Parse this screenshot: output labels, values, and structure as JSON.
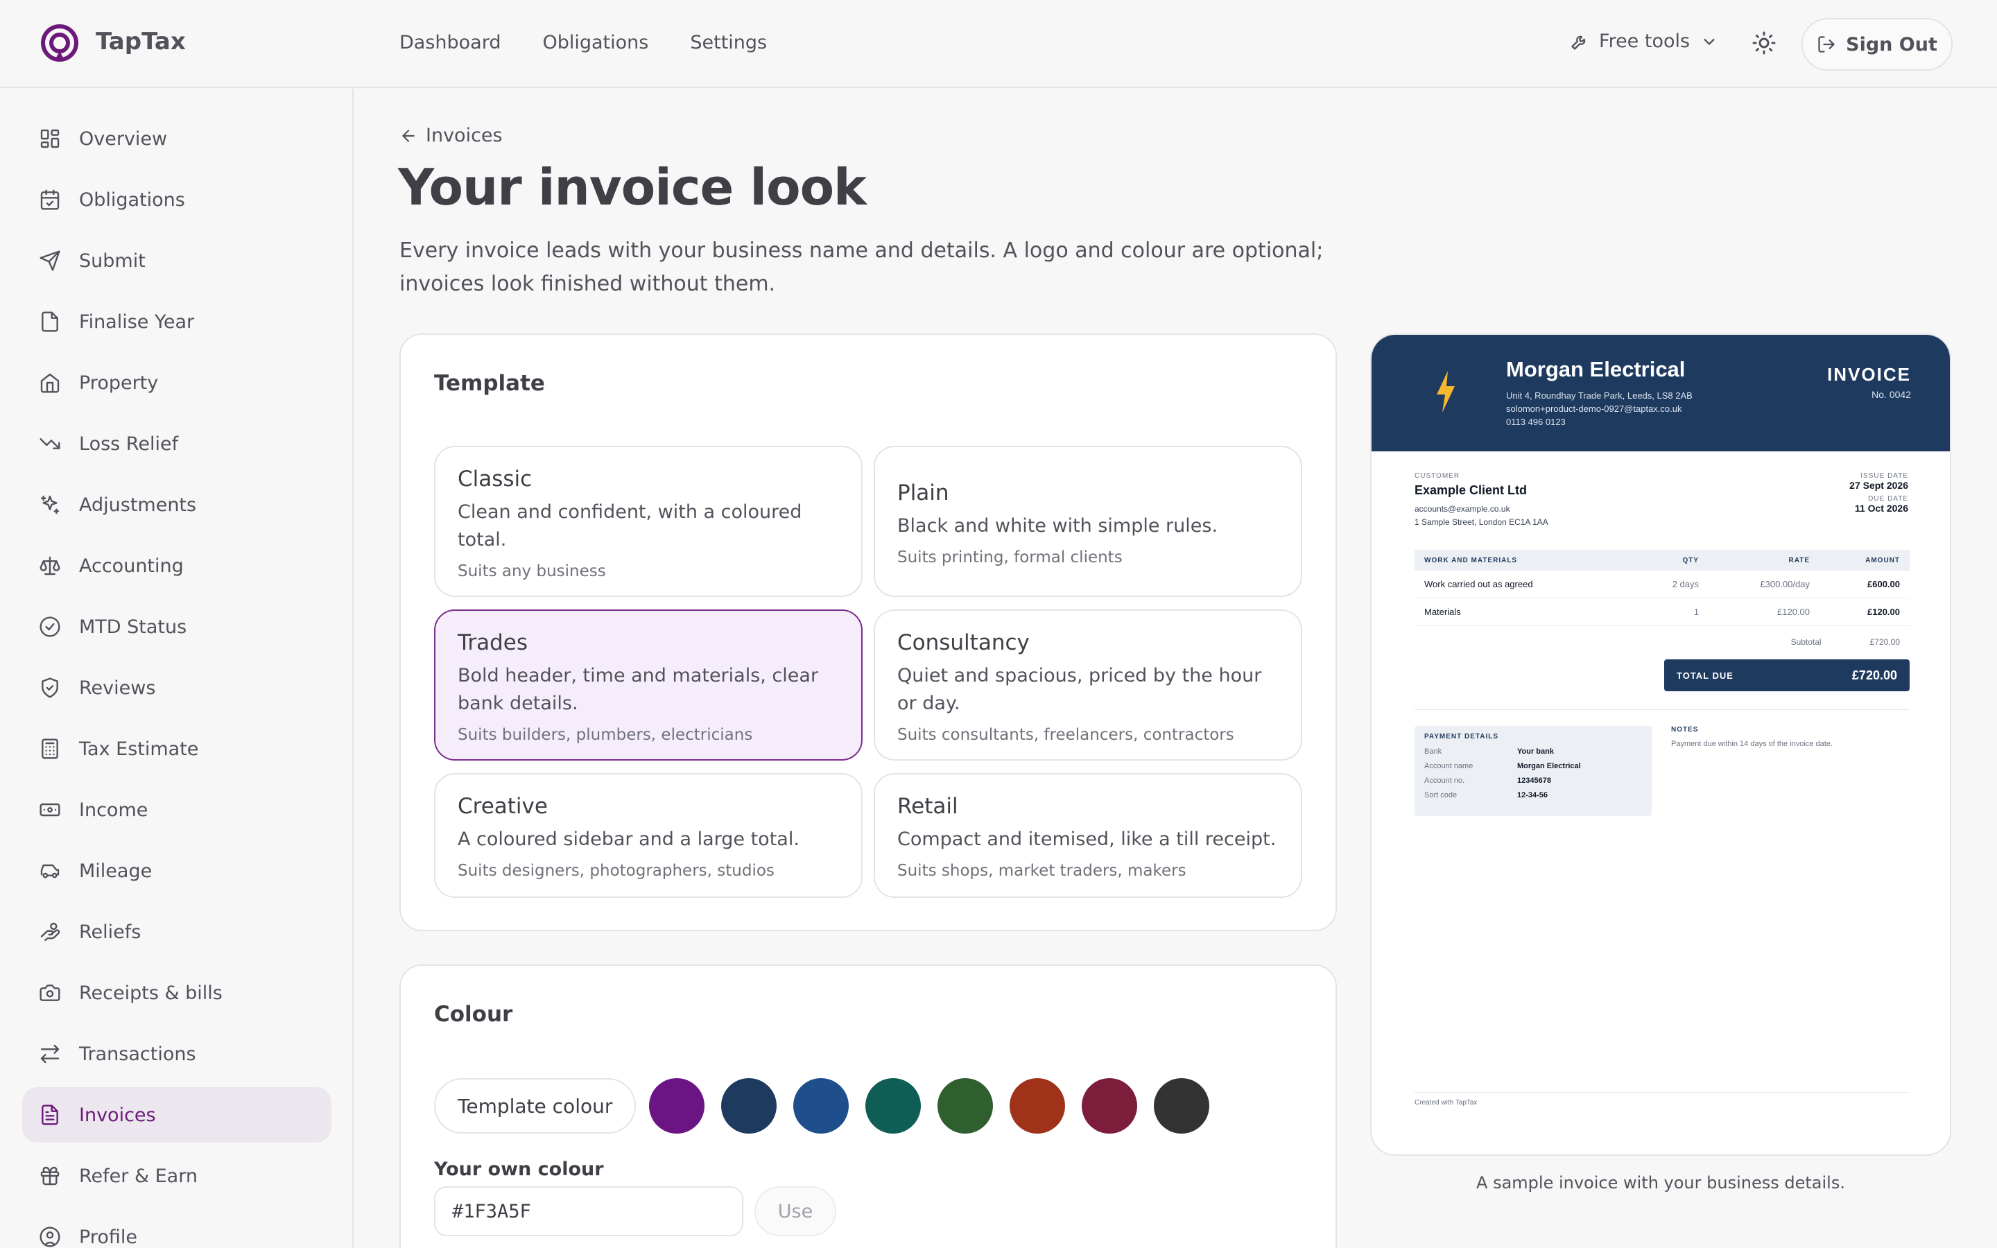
{
  "app": {
    "name": "TapTax"
  },
  "topnav": [
    "Dashboard",
    "Obligations",
    "Settings"
  ],
  "header": {
    "free_tools": "Free tools",
    "sign_out": "Sign Out"
  },
  "sidebar": {
    "items": [
      {
        "label": "Overview",
        "icon": "grid-icon"
      },
      {
        "label": "Obligations",
        "icon": "calendar-check-icon"
      },
      {
        "label": "Submit",
        "icon": "send-icon"
      },
      {
        "label": "Finalise Year",
        "icon": "file-check-icon"
      },
      {
        "label": "Property",
        "icon": "home-icon"
      },
      {
        "label": "Loss Relief",
        "icon": "trending-down-icon"
      },
      {
        "label": "Adjustments",
        "icon": "sparkles-icon"
      },
      {
        "label": "Accounting",
        "icon": "scale-icon"
      },
      {
        "label": "MTD Status",
        "icon": "check-circle-icon"
      },
      {
        "label": "Reviews",
        "icon": "shield-check-icon"
      },
      {
        "label": "Tax Estimate",
        "icon": "calculator-icon"
      },
      {
        "label": "Income",
        "icon": "banknote-icon"
      },
      {
        "label": "Mileage",
        "icon": "car-icon"
      },
      {
        "label": "Reliefs",
        "icon": "hand-coins-icon"
      },
      {
        "label": "Receipts & bills",
        "icon": "camera-icon"
      },
      {
        "label": "Transactions",
        "icon": "arrows-icon"
      },
      {
        "label": "Invoices",
        "icon": "file-text-icon",
        "active": true
      },
      {
        "label": "Refer & Earn",
        "icon": "gift-icon"
      },
      {
        "label": "Profile",
        "icon": "user-circle-icon"
      }
    ]
  },
  "page": {
    "back": "Invoices",
    "title": "Your invoice look",
    "subtitle": "Every invoice leads with your business name and details. A logo and colour are optional; invoices look finished without them."
  },
  "template": {
    "title": "Template",
    "options": [
      {
        "name": "Classic",
        "desc": "Clean and confident, with a coloured total.",
        "suits": "Suits any business"
      },
      {
        "name": "Plain",
        "desc": "Black and white with simple rules.",
        "suits": "Suits printing, formal clients"
      },
      {
        "name": "Trades",
        "desc": "Bold header, time and materials, clear bank details.",
        "suits": "Suits builders, plumbers, electricians",
        "selected": true
      },
      {
        "name": "Consultancy",
        "desc": "Quiet and spacious, priced by the hour or day.",
        "suits": "Suits consultants, freelancers, contractors"
      },
      {
        "name": "Creative",
        "desc": "A coloured sidebar and a large total.",
        "suits": "Suits designers, photographers, studios"
      },
      {
        "name": "Retail",
        "desc": "Compact and itemised, like a till receipt.",
        "suits": "Suits shops, market traders, makers"
      }
    ]
  },
  "colour": {
    "title": "Colour",
    "template_colour": "Template colour",
    "swatches": [
      "#6b1585",
      "#1f3a5f",
      "#1e4e8c",
      "#0f5e56",
      "#2f5e2f",
      "#a0321a",
      "#7c1d3c",
      "#333333"
    ],
    "own_label": "Your own colour",
    "own_value": "#1F3A5F",
    "use": "Use"
  },
  "invoice": {
    "business": "Morgan Electrical",
    "address": "Unit 4, Roundhay Trade Park, Leeds, LS8 2AB",
    "email": "solomon+product-demo-0927@taptax.co.uk",
    "phone": "0113 496 0123",
    "word": "INVOICE",
    "number": "No. 0042",
    "customer_label": "CUSTOMER",
    "customer": "Example Client Ltd",
    "customer_email": "accounts@example.co.uk",
    "customer_address": "1 Sample Street, London EC1A 1AA",
    "issue_label": "ISSUE DATE",
    "issue_date": "27 Sept 2026",
    "due_label": "DUE DATE",
    "due_date": "11 Oct 2026",
    "headers": [
      "WORK AND MATERIALS",
      "QTY",
      "RATE",
      "AMOUNT"
    ],
    "rows": [
      [
        "Work carried out as agreed",
        "2 days",
        "£300.00/day",
        "£600.00"
      ],
      [
        "Materials",
        "1",
        "£120.00",
        "£120.00"
      ]
    ],
    "subtotal_label": "Subtotal",
    "subtotal": "£720.00",
    "total_label": "TOTAL DUE",
    "total": "£720.00",
    "payment_title": "PAYMENT DETAILS",
    "payment": [
      [
        "Bank",
        "Your bank"
      ],
      [
        "Account name",
        "Morgan Electrical"
      ],
      [
        "Account no.",
        "12345678"
      ],
      [
        "Sort code",
        "12-34-56"
      ]
    ],
    "notes_title": "NOTES",
    "notes": "Payment due within 14 days of the invoice date.",
    "footer": "Created with TapTax",
    "accent": "#1f3a5f"
  },
  "caption": "A sample invoice with your business details."
}
